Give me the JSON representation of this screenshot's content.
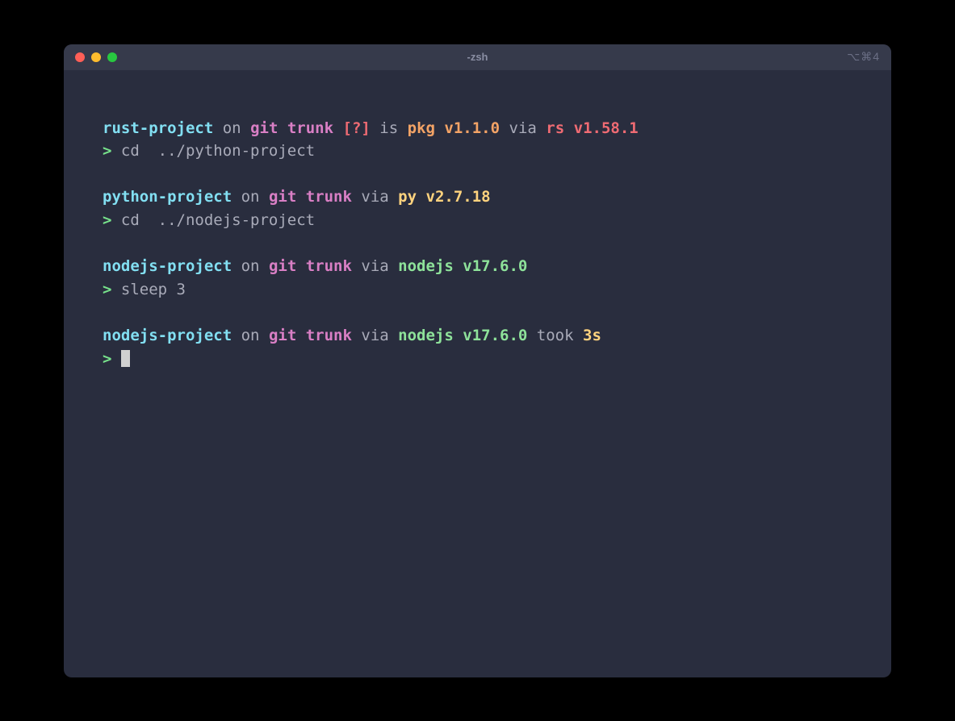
{
  "window": {
    "title": "-zsh",
    "rightIndicator": "⌥⌘4"
  },
  "blocks": [
    {
      "project": "rust-project",
      "on": "on",
      "vcs": "git",
      "branch": "trunk",
      "status": "[?]",
      "is": "is",
      "pkgLabel": "pkg",
      "pkgVersion": "v1.1.0",
      "via": "via",
      "runtimeLabel": "rs",
      "runtimeVersion": "v1.58.1",
      "promptSymbol": ">",
      "command": "cd  ../python-project"
    },
    {
      "project": "python-project",
      "on": "on",
      "vcs": "git",
      "branch": "trunk",
      "via": "via",
      "runtimeLabel": "py",
      "runtimeVersion": "v2.7.18",
      "promptSymbol": ">",
      "command": "cd  ../nodejs-project"
    },
    {
      "project": "nodejs-project",
      "on": "on",
      "vcs": "git",
      "branch": "trunk",
      "via": "via",
      "runtimeLabel": "nodejs",
      "runtimeVersion": "v17.6.0",
      "promptSymbol": ">",
      "command": "sleep 3"
    },
    {
      "project": "nodejs-project",
      "on": "on",
      "vcs": "git",
      "branch": "trunk",
      "via": "via",
      "runtimeLabel": "nodejs",
      "runtimeVersion": "v17.6.0",
      "took": "took",
      "duration": "3s",
      "promptSymbol": ">",
      "command": ""
    }
  ]
}
